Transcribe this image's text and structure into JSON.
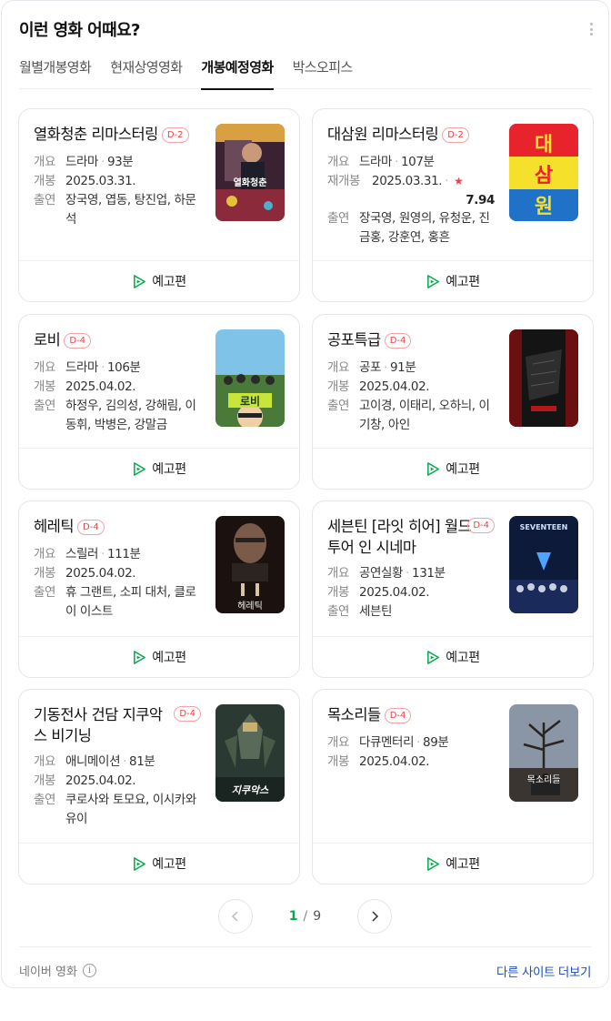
{
  "header": {
    "title": "이런 영화 어때요?"
  },
  "tabs": [
    {
      "label": "월별개봉영화"
    },
    {
      "label": "현재상영영화"
    },
    {
      "label": "개봉예정영화"
    },
    {
      "label": "박스오피스"
    }
  ],
  "labels": {
    "overview": "개요",
    "release": "개봉",
    "rerelease": "재개봉",
    "cast": "출연",
    "trailer": "예고편"
  },
  "movies": [
    {
      "title": "열화청춘 리마스터링",
      "dday": "D-2",
      "genre": "드라마",
      "runtime": "93분",
      "date": "2025.03.31.",
      "cast": "장국영, 엽동, 탕진업, 하문석",
      "poster_text": "열화청춘"
    },
    {
      "title": "대삼원 리마스터링",
      "dday": "D-2",
      "genre": "드라마",
      "runtime": "107분",
      "date": "2025.03.31.",
      "score": "7.94",
      "cast": "장국영, 원영의, 유청운, 진금홍, 강훈연, 홍흔",
      "poster_text": "대삼원"
    },
    {
      "title": "로비",
      "dday": "D-4",
      "genre": "드라마",
      "runtime": "106분",
      "date": "2025.04.02.",
      "cast": "하정우, 김의성, 강해림, 이동휘, 박병은, 강말금",
      "poster_text": "로비"
    },
    {
      "title": "공포특급",
      "dday": "D-4",
      "genre": "공포",
      "runtime": "91분",
      "date": "2025.04.02.",
      "cast": "고이경, 이태리, 오하늬, 이기창, 아인",
      "poster_text": ""
    },
    {
      "title": "헤레틱",
      "dday": "D-4",
      "genre": "스릴러",
      "runtime": "111분",
      "date": "2025.04.02.",
      "cast": "휴 그랜트, 소피 대처, 클로이 이스트",
      "poster_text": "헤레틱"
    },
    {
      "title": "세븐틴 [라잇 히어] 월드 투어 인 시네마",
      "dday": "D-4",
      "genre": "공연실황",
      "runtime": "131분",
      "date": "2025.04.02.",
      "cast": "세븐틴",
      "poster_text": "SEVENTEEN"
    },
    {
      "title": "기동전사 건담 지쿠악스 비기닝",
      "dday": "D-4",
      "genre": "애니메이션",
      "runtime": "81분",
      "date": "2025.04.02.",
      "cast": "쿠로사와 토모요, 이시카와 유이",
      "poster_text": "지쿠악스"
    },
    {
      "title": "목소리들",
      "dday": "D-4",
      "genre": "다큐멘터리",
      "runtime": "89분",
      "date": "2025.04.02.",
      "poster_text": "목소리들"
    }
  ],
  "pager": {
    "current": "1",
    "separator": "/",
    "total": "9"
  },
  "footer": {
    "source": "네이버 영화",
    "other_sites": "다른 사이트 더보기"
  },
  "colors": {
    "accent_green": "#03a94d",
    "dday_red": "#e5454a",
    "link_blue": "#1d4fb0"
  }
}
